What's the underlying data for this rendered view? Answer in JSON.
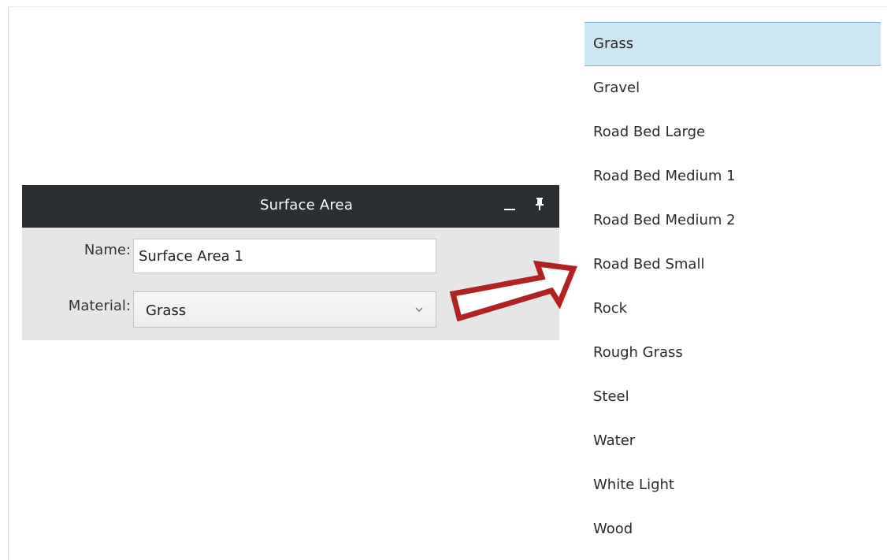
{
  "panel": {
    "title": "Surface Area",
    "minimize_icon": "minimize-icon",
    "pin_icon": "pin-icon",
    "name_label": "Name:",
    "name_value": "Surface Area 1",
    "material_label": "Material:",
    "material_value": "Grass"
  },
  "dropdown": {
    "options": [
      "Grass",
      "Gravel",
      "Road Bed Large",
      "Road Bed Medium 1",
      "Road Bed Medium 2",
      "Road Bed Small",
      "Rock",
      "Rough Grass",
      "Steel",
      "Water",
      "White Light",
      "Wood"
    ],
    "selected": "Grass"
  },
  "colors": {
    "header_bg": "#2b2f33",
    "panel_bg": "#e6e6e6",
    "selected_bg": "#cde6f3",
    "arrow": "#b22222"
  }
}
